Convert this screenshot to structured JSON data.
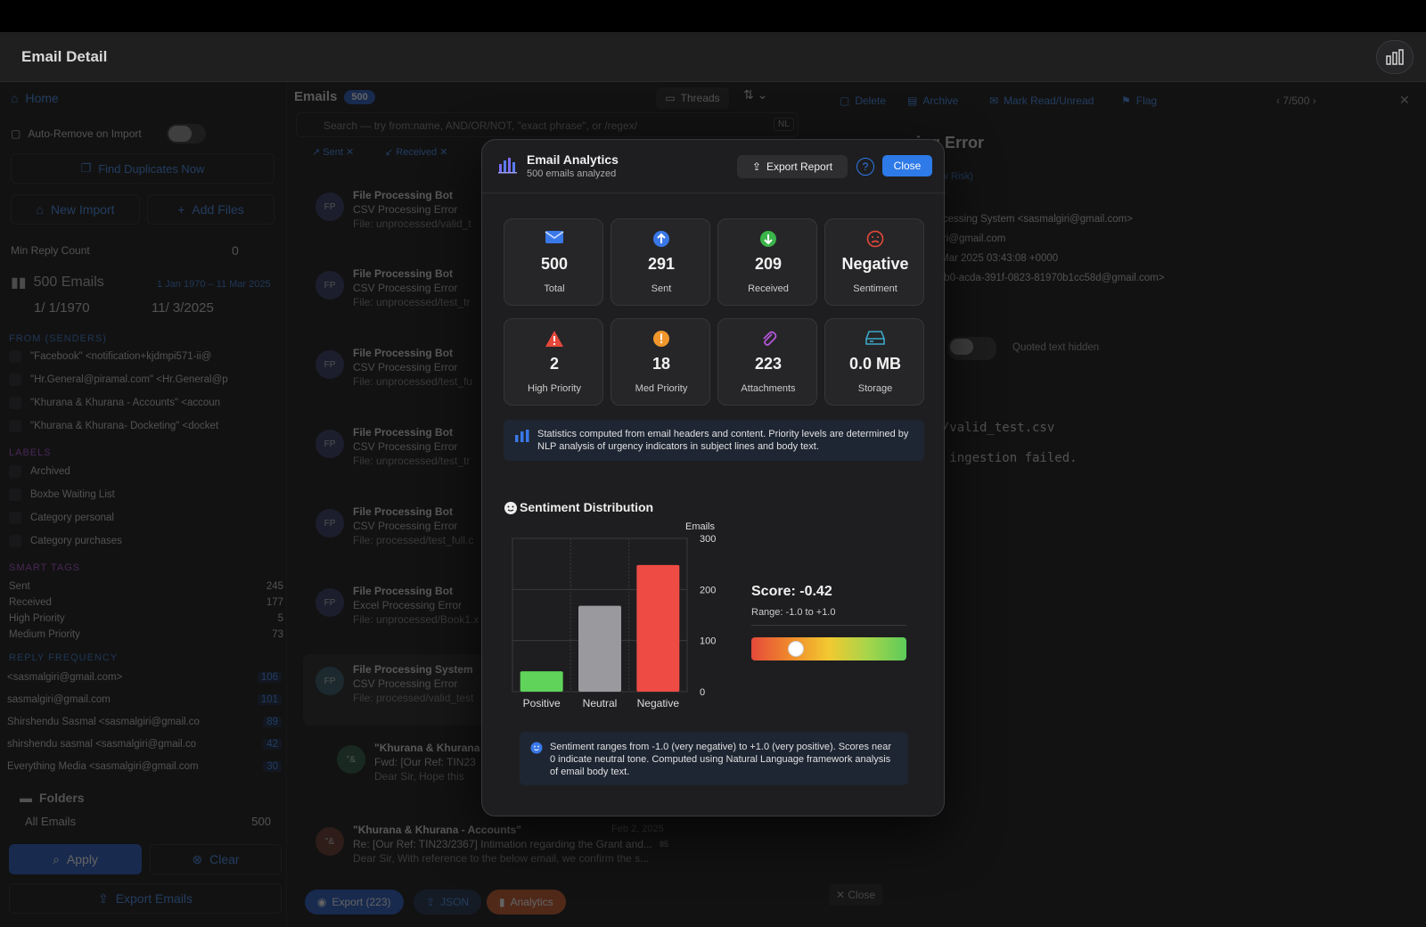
{
  "window": {
    "title": "Email Detail"
  },
  "sidebar": {
    "home": "Home",
    "auto_remove": "Auto-Remove on Import",
    "find_duplicates": "Find Duplicates Now",
    "new_import": "New Import",
    "add_files": "Add Files",
    "min_reply_label": "Min Reply Count",
    "min_reply_value": "0",
    "email_count": "500 Emails",
    "date_range": "1 Jan 1970 – 11 Mar 2025",
    "date_from": "1/  1/1970",
    "date_to": "11/  3/2025",
    "from_section": "FROM (SENDERS)",
    "senders": [
      "\"Facebook\" <notification+kjdmpi571-ii@",
      "\"Hr.General@piramal.com\" <Hr.General@p",
      "\"Khurana & Khurana - Accounts\" <accoun",
      "\"Khurana & Khurana- Docketing\" <docket"
    ],
    "labels_section": "LABELS",
    "labels": [
      "Archived",
      "Boxbe Waiting List",
      "Category personal",
      "Category purchases"
    ],
    "smart_tags_section": "SMART TAGS",
    "smart_tags": [
      {
        "label": "Sent",
        "count": "245"
      },
      {
        "label": "Received",
        "count": "177"
      },
      {
        "label": "High Priority",
        "count": "5"
      },
      {
        "label": "Medium Priority",
        "count": "73"
      }
    ],
    "reply_section": "REPLY FREQUENCY",
    "reply_freq": [
      {
        "label": "<sasmalgiri@gmail.com>",
        "count": "106"
      },
      {
        "label": "sasmalgiri@gmail.com",
        "count": "101"
      },
      {
        "label": "Shirshendu Sasmal <sasmalgiri@gmail.co",
        "count": "89"
      },
      {
        "label": "shirshendu sasmal <sasmalgiri@gmail.co",
        "count": "42"
      },
      {
        "label": "Everything Media <sasmalgiri@gmail.com",
        "count": "30"
      }
    ],
    "folders": "Folders",
    "all_emails": "All Emails",
    "all_emails_count": "500",
    "apply": "Apply",
    "clear": "Clear",
    "export_emails": "Export Emails"
  },
  "list": {
    "title": "Emails",
    "count": "500",
    "threads": "Threads",
    "search_placeholder": "Search — try from:name, AND/OR/NOT, \"exact phrase\", or /regex/",
    "nl": "NL",
    "filter_sent": "Sent",
    "filter_received": "Received",
    "emails": [
      {
        "avatar": "FP",
        "from": "File Processing Bot",
        "subject": "CSV Processing Error",
        "preview": "File: unprocessed/valid_t"
      },
      {
        "avatar": "FP",
        "from": "File Processing Bot",
        "subject": "CSV Processing Error",
        "preview": "File: unprocessed/test_tr"
      },
      {
        "avatar": "FP",
        "from": "File Processing Bot",
        "subject": "CSV Processing Error",
        "preview": "File: unprocessed/test_fu"
      },
      {
        "avatar": "FP",
        "from": "File Processing Bot",
        "subject": "CSV Processing Error",
        "preview": "File: unprocessed/test_tr"
      },
      {
        "avatar": "FP",
        "from": "File Processing Bot",
        "subject": "CSV Processing Error",
        "preview": "File: processed/test_full.c"
      },
      {
        "avatar": "FP",
        "from": "File Processing Bot",
        "subject": "Excel Processing Error",
        "preview": "File: unprocessed/Book1.x"
      },
      {
        "avatar": "FP",
        "from": "File Processing System",
        "subject": "CSV Processing Error",
        "preview": "File: processed/valid_test"
      },
      {
        "avatar": "\"&",
        "from": "\"Khurana & Khurana",
        "subject": "Fwd: [Our Ref: TIN23",
        "preview": "Dear Sir,    Hope this"
      }
    ],
    "last_email": {
      "avatar": "\"&",
      "from": "\"Khurana & Khurana - Accounts\"",
      "date": "Feb 2, 2025",
      "subject": "Re: [Our Ref: TIN23/2367] Intimation regarding the Grant and...",
      "preview": "Dear Sir,  With reference to the below email, we confirm the s...",
      "badge": "85"
    },
    "export": "Export (223)",
    "json": "JSON",
    "analytics": "Analytics"
  },
  "detail": {
    "toolbar": [
      "Delete",
      "Archive",
      "Mark Read/Unread",
      "Flag"
    ],
    "pager": "7/500",
    "subject": "ing Error",
    "risk": "(Low Risk)",
    "from": "Processing System <sasmalgiri@gmail.com>",
    "to": "algiri@gmail.com",
    "date": "11 Mar 2025 03:43:08 +0000",
    "msgid": "be4b0-acda-391f-0823-81970b1cc58d@gmail.com>",
    "view_label": "w",
    "quoted": "Quoted text hidden",
    "body1": "ed/valid_test.csv",
    "body2": "ry ingestion failed.",
    "close": "Close"
  },
  "modal": {
    "title": "Email Analytics",
    "subtitle": "500 emails analyzed",
    "export_report": "Export Report",
    "help": "?",
    "close": "Close",
    "stats": [
      {
        "value": "500",
        "label": "Total",
        "icon": "envelope-icon"
      },
      {
        "value": "291",
        "label": "Sent",
        "icon": "arrow-up-circle-icon"
      },
      {
        "value": "209",
        "label": "Received",
        "icon": "arrow-down-circle-icon"
      },
      {
        "value": "Negative",
        "label": "Sentiment",
        "icon": "frown-icon"
      },
      {
        "value": "2",
        "label": "High Priority",
        "icon": "warning-triangle-icon"
      },
      {
        "value": "18",
        "label": "Med Priority",
        "icon": "exclamation-circle-icon"
      },
      {
        "value": "223",
        "label": "Attachments",
        "icon": "paperclip-icon"
      },
      {
        "value": "0.0 MB",
        "label": "Storage",
        "icon": "drive-icon"
      }
    ],
    "info": "Statistics computed from email headers and content. Priority levels are determined by NLP analysis of urgency indicators in subject lines and body text.",
    "sentiment_title": "Sentiment Distribution",
    "score": "Score: -0.42",
    "range": "Range: -1.0 to +1.0",
    "score_fraction": 0.29,
    "note": "Sentiment ranges from -1.0 (very negative) to +1.0 (very positive). Scores near 0 indicate neutral tone. Computed using Natural Language framework analysis of email body text."
  },
  "chart_data": {
    "type": "bar",
    "categories": [
      "Positive",
      "Neutral",
      "Negative"
    ],
    "values": [
      40,
      168,
      248
    ],
    "colors": [
      "#5fd35a",
      "#9a9a9e",
      "#ee4b44"
    ],
    "ylabel": "Emails",
    "ylim": [
      0,
      300
    ],
    "yticks": [
      0,
      100,
      200,
      300
    ],
    "grid": true
  }
}
